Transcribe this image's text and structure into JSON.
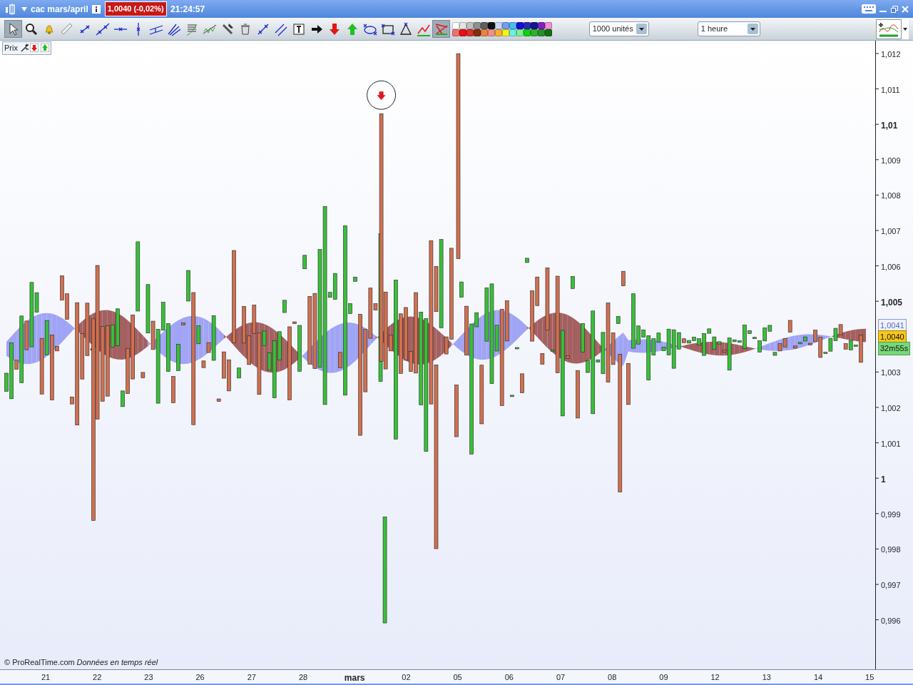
{
  "window": {
    "title": "cac mars/april",
    "price": "1,0040 (-0,02%)",
    "time": "21:24:57"
  },
  "toolbar": {
    "tools": [
      {
        "kind": "pointer",
        "selected": true
      },
      {
        "kind": "zoom",
        "selected": false
      },
      {
        "kind": "bell",
        "selected": false
      },
      {
        "kind": "ruler",
        "selected": false
      },
      {
        "kind": "segment",
        "selected": false
      },
      {
        "kind": "line",
        "selected": false
      },
      {
        "kind": "hline",
        "selected": false
      },
      {
        "kind": "vline",
        "selected": false
      },
      {
        "kind": "channel",
        "selected": false
      },
      {
        "kind": "fan",
        "selected": false
      },
      {
        "kind": "fib",
        "selected": false
      },
      {
        "kind": "wave",
        "selected": false
      },
      {
        "kind": "hammer",
        "selected": false
      },
      {
        "kind": "trash",
        "selected": false
      },
      {
        "kind": "cross",
        "selected": false
      },
      {
        "kind": "parallel",
        "selected": false
      },
      {
        "kind": "text",
        "selected": false
      },
      {
        "kind": "arrow-black",
        "selected": false
      },
      {
        "kind": "arrow-down",
        "selected": false
      },
      {
        "kind": "arrow-up",
        "selected": false
      },
      {
        "kind": "ellipse",
        "selected": false
      },
      {
        "kind": "rectangle",
        "selected": false
      },
      {
        "kind": "triangle",
        "selected": false
      },
      {
        "kind": "trend",
        "selected": false
      },
      {
        "kind": "signal",
        "selected": true
      }
    ],
    "palette": [
      {
        "color": "#ffffff"
      },
      {
        "color": "#e4e4e4"
      },
      {
        "color": "#c0c0c0"
      },
      {
        "color": "#909090"
      },
      {
        "color": "#606060"
      },
      {
        "color": "#101010"
      },
      {
        "color": "#c8d8f8"
      },
      {
        "color": "#6fa0f0"
      },
      {
        "color": "#50b8f8"
      },
      {
        "color": "#1010d8"
      },
      {
        "color": "#2828b8"
      },
      {
        "color": "#101890"
      },
      {
        "color": "#8020c0"
      },
      {
        "color": "#f090d0"
      },
      {
        "color": "#f07070"
      },
      {
        "color": "#e81010"
      },
      {
        "color": "#d83030"
      },
      {
        "color": "#803010"
      },
      {
        "color": "#f08040"
      },
      {
        "color": "#f09090"
      },
      {
        "color": "#f8b030"
      },
      {
        "color": "#f8f020"
      },
      {
        "color": "#70f0e0"
      },
      {
        "color": "#80f090"
      },
      {
        "color": "#10d010"
      },
      {
        "color": "#30b030"
      },
      {
        "color": "#289028"
      },
      {
        "color": "#107010"
      }
    ],
    "units": "1000 unités",
    "period": "1 heure"
  },
  "panel": {
    "label": "Prix"
  },
  "price_axis": {
    "ticks": [
      {
        "label": "1,012",
        "major": false
      },
      {
        "label": "1,011",
        "major": false
      },
      {
        "label": "1,01",
        "major": true
      },
      {
        "label": "1,009",
        "major": false
      },
      {
        "label": "1,008",
        "major": false
      },
      {
        "label": "1,007",
        "major": false
      },
      {
        "label": "1,006",
        "major": false
      },
      {
        "label": "1,005",
        "major": true
      },
      {
        "label": "1,003",
        "major": false
      },
      {
        "label": "1,002",
        "major": false
      },
      {
        "label": "1,001",
        "major": false
      },
      {
        "label": "1",
        "major": true
      },
      {
        "label": "0,999",
        "major": false
      },
      {
        "label": "0,998",
        "major": false
      },
      {
        "label": "0,997",
        "major": false
      },
      {
        "label": "0,996",
        "major": false
      }
    ],
    "cloud_label": "1,0041",
    "last_price": "1,0040",
    "countdown": "32m55s"
  },
  "time_axis": {
    "ticks": [
      {
        "label": "21",
        "major": false
      },
      {
        "label": "22",
        "major": false
      },
      {
        "label": "23",
        "major": false
      },
      {
        "label": "26",
        "major": false
      },
      {
        "label": "27",
        "major": false
      },
      {
        "label": "28",
        "major": false
      },
      {
        "label": "mars",
        "major": true
      },
      {
        "label": "02",
        "major": false
      },
      {
        "label": "05",
        "major": false
      },
      {
        "label": "06",
        "major": false
      },
      {
        "label": "07",
        "major": false
      },
      {
        "label": "08",
        "major": false
      },
      {
        "label": "09",
        "major": false
      },
      {
        "label": "12",
        "major": false
      },
      {
        "label": "13",
        "major": false
      },
      {
        "label": "14",
        "major": false
      },
      {
        "label": "15",
        "major": false
      }
    ]
  },
  "footer": {
    "copyright": "© ProRealTime.com",
    "source": "Données en temps réel"
  }
}
